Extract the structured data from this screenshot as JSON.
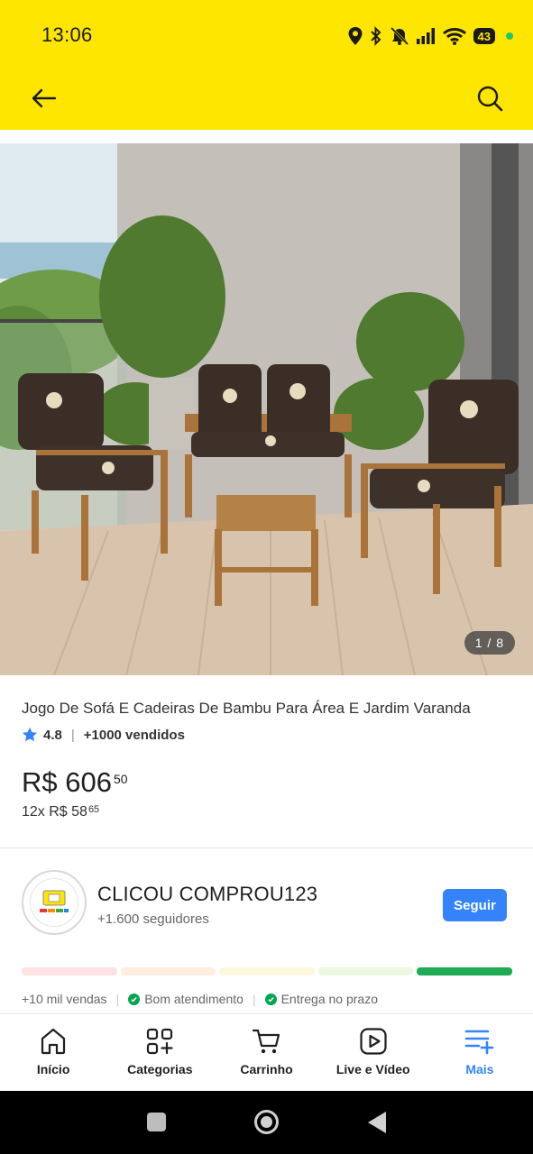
{
  "status_bar": {
    "time": "13:06",
    "battery": "43"
  },
  "header": {
    "back_icon": "arrow-left-icon",
    "search_icon": "search-icon",
    "background": "#ffe600"
  },
  "gallery": {
    "counter": "1 / 8"
  },
  "product": {
    "title": "Jogo De Sofá E Cadeiras De Bambu Para Área E Jardim  Varanda",
    "rating": "4.8",
    "sold": "+1000 vendidos",
    "price_main": "R$ 606",
    "price_cents": "50",
    "installment_main": "12x R$ 58",
    "installment_cents": "65"
  },
  "seller": {
    "name": "CLICOU COMPROU123",
    "followers": "+1.600 seguidores",
    "follow_label": "Seguir",
    "reputation_colors": [
      "#fde2e1",
      "#feeee2",
      "#fdf8dd",
      "#ecf9e2",
      "#1fab54"
    ],
    "sales": "+10 mil vendas",
    "service": "Bom atendimento",
    "delivery": "Entrega no prazo"
  },
  "tabbar": {
    "items": [
      {
        "label": "Início",
        "icon": "home-icon"
      },
      {
        "label": "Categorias",
        "icon": "categories-icon"
      },
      {
        "label": "Carrinho",
        "icon": "cart-icon"
      },
      {
        "label": "Live e Vídeo",
        "icon": "video-icon"
      },
      {
        "label": "Mais",
        "icon": "menu-plus-icon"
      }
    ],
    "active_color": "#3483fa"
  }
}
